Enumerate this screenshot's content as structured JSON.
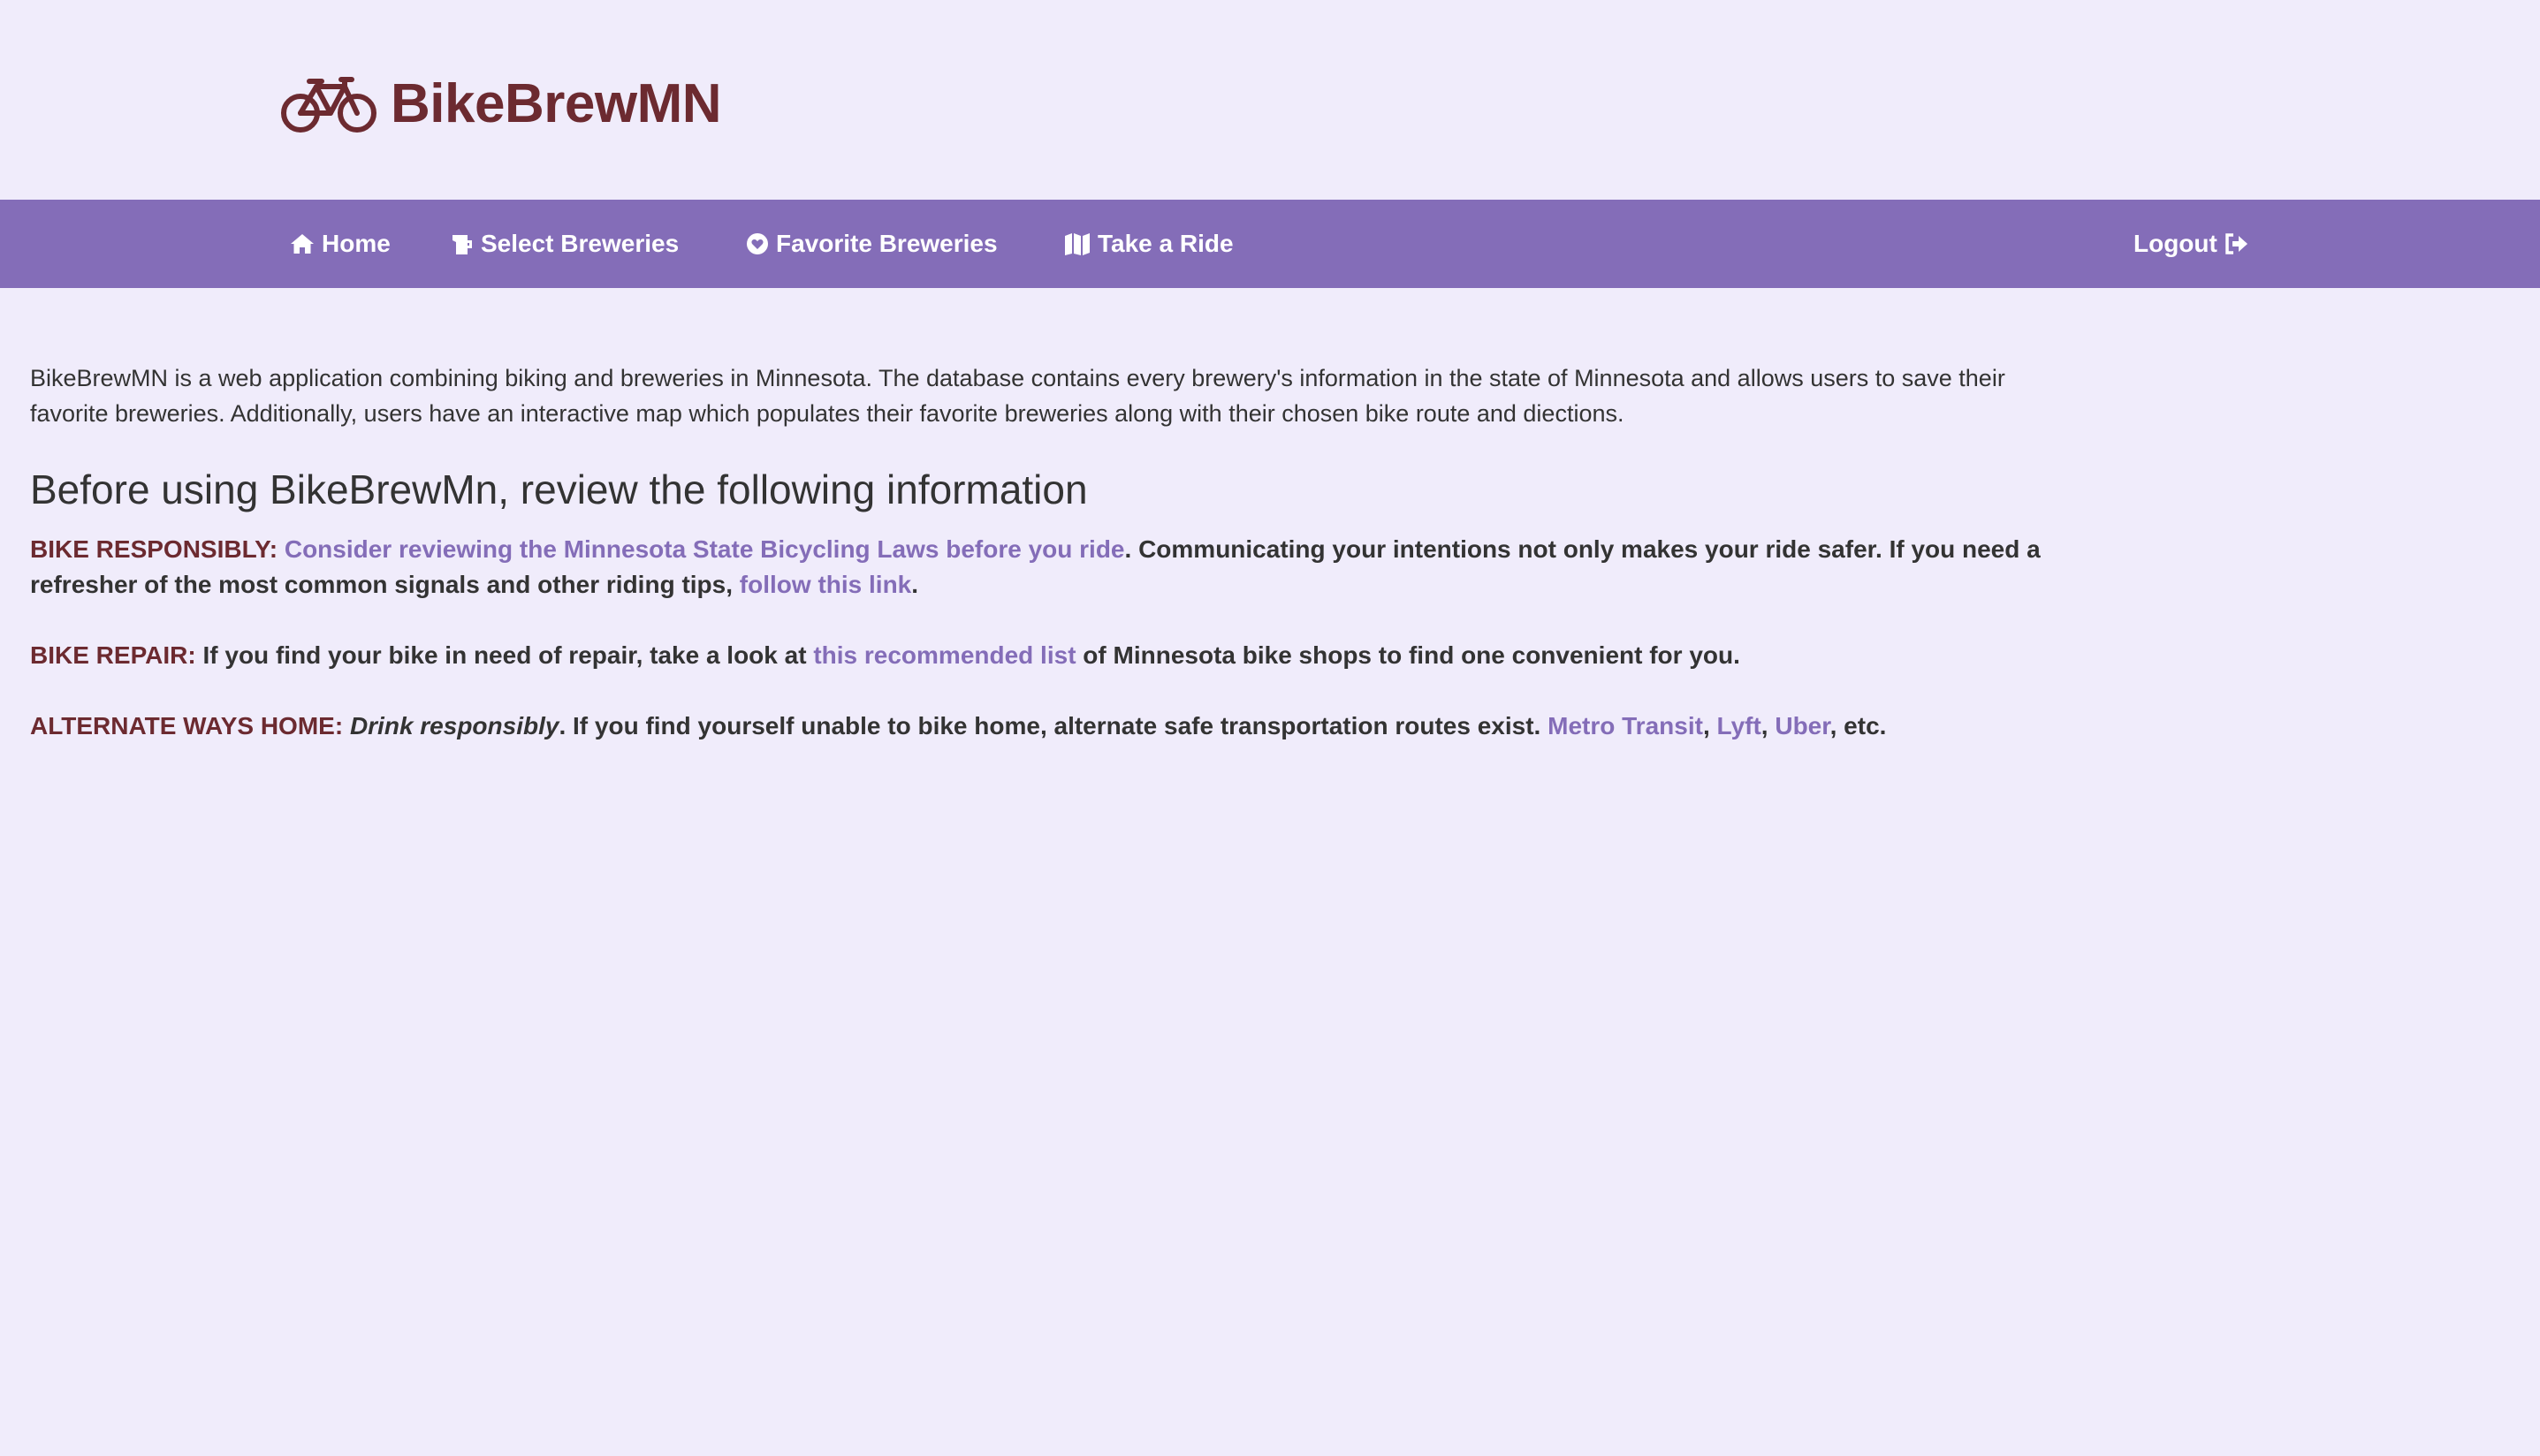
{
  "brand": {
    "name": "BikeBrewMN",
    "icon": "bicycle-icon",
    "color": "#6c2a30"
  },
  "colors": {
    "background": "#f0ecfb",
    "navbar": "#846db8",
    "link": "#846db8",
    "label": "#6c2a30"
  },
  "nav": {
    "home": {
      "label": "Home",
      "icon": "home-icon"
    },
    "select": {
      "label": "Select Breweries",
      "icon": "beer-icon"
    },
    "favorite": {
      "label": "Favorite Breweries",
      "icon": "heart-circle-icon"
    },
    "ride": {
      "label": "Take a Ride",
      "icon": "map-icon"
    },
    "logout": {
      "label": "Logout",
      "icon": "sign-out-icon"
    }
  },
  "intro": "BikeBrewMN is a web application combining biking and breweries in Minnesota. The database contains every brewery's information in the state of Minnesota and allows users to save their favorite breweries. Additionally, users have an interactive map which populates their favorite breweries along with their chosen bike route and diections.",
  "heading": "Before using BikeBrewMn, review the following information",
  "responsibly": {
    "label": "BIKE RESPONSIBLY:",
    "link1": "Consider reviewing the Minnesota State Bicycling Laws before you ride",
    "text1": ". Communicating your intentions not only makes your ride safer. If you need a refresher of the most common signals and other riding tips,",
    "link2": "follow this link",
    "text2": "."
  },
  "repair": {
    "label": "BIKE REPAIR:",
    "text1": "If you find your bike in need of repair, take a look at",
    "link": "this recommended list",
    "text2": "of Minnesota bike shops to find one convenient for you."
  },
  "alternate": {
    "label": "ALTERNATE WAYS HOME:",
    "emphasis": "Drink responsibly",
    "text1": ". If you find yourself unable to bike home, alternate safe transportation routes exist.",
    "link_metro": "Metro Transit",
    "sep1": ",",
    "link_lyft": "Lyft",
    "sep2": ",",
    "link_uber": "Uber",
    "text2": ", etc."
  }
}
